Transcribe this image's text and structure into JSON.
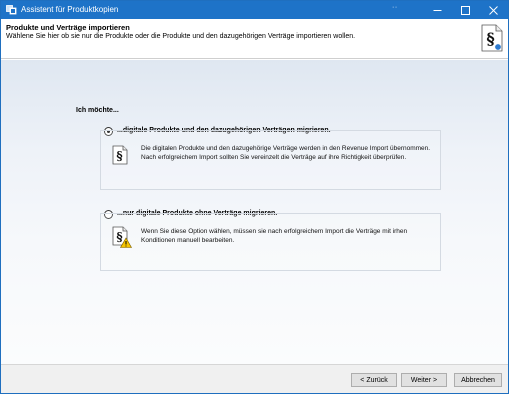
{
  "window": {
    "title": "Assistent für Produktkopien",
    "title_dots": "··",
    "colors": {
      "titlebar": "#1e73c8",
      "border": "#1f6fbf"
    }
  },
  "header": {
    "title": "Produkte und Verträge importieren",
    "subtitle": "Wählene Sie hier ob sie nur die Produkte oder die Produkte und den dazugehörigen Verträge importieren wollen.",
    "logo_icon": "section-sign-document-icon",
    "logo_glyph": "§"
  },
  "body": {
    "intro": "Ich möchte...",
    "options": [
      {
        "label": "...digitale Produkte und den dazugehörigen Verträgen migrieren.",
        "selected": true,
        "icon": "section-sign-document-icon",
        "icon_glyph": "§",
        "description": "Die digitalen Produkte und den dazugehörige Verträge werden in den Revenue Import übernommen. Nach erfolgreichem Import sollten Sie vereinzelt die Verträge auf ihre Richtigkeit überprüfen."
      },
      {
        "label": "...nur digitale Produkte ohne Verträge migrieren.",
        "selected": false,
        "icon": "section-sign-warning-icon",
        "icon_glyph": "§",
        "description": "Wenn Sie diese Option wählen, müssen sie nach erfolgreichem Import die Verträge mit irhen Konditionen manuell bearbeiten."
      }
    ]
  },
  "footer": {
    "back_label": "< Zurück",
    "next_label": "Weiter >",
    "cancel_label": "Abbrechen"
  }
}
